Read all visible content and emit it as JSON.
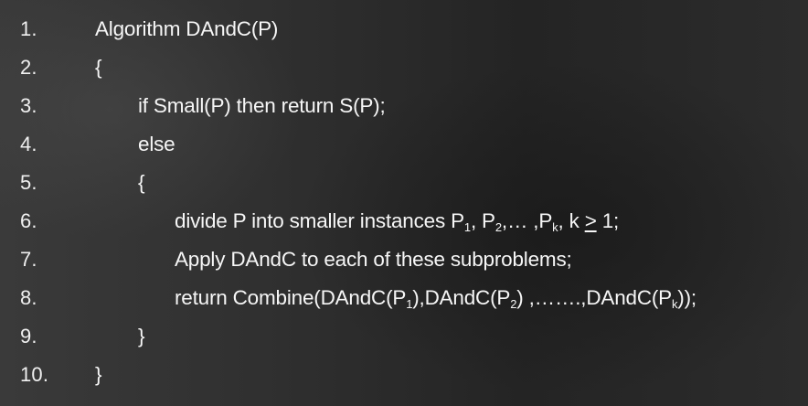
{
  "lines": [
    {
      "num": "1.",
      "text": "Algorithm DAndC(P)"
    },
    {
      "num": "2.",
      "text": "{"
    },
    {
      "num": "3.",
      "text": "if Small(P) then return S(P);"
    },
    {
      "num": "4.",
      "text": "else"
    },
    {
      "num": "5.",
      "text": "{"
    },
    {
      "num": "6.",
      "parts": {
        "a": "divide P into smaller instances P",
        "s1": "1",
        "b": ", P",
        "s2": "2",
        "c": ",… ,P",
        "sk": "k",
        "d": ", k ",
        "ge": ">",
        "e": " 1;"
      }
    },
    {
      "num": "7.",
      "text": "Apply DAndC to each of these subproblems;"
    },
    {
      "num": "8.",
      "parts": {
        "a": "return Combine(DAndC(P",
        "s1": "1",
        "b": "),DAndC(P",
        "s2": "2",
        "c": ") ,…….,DAndC(P",
        "sk": "k",
        "d": "));"
      }
    },
    {
      "num": "9.",
      "text": "}"
    },
    {
      "num": "10.",
      "text": "}"
    }
  ]
}
